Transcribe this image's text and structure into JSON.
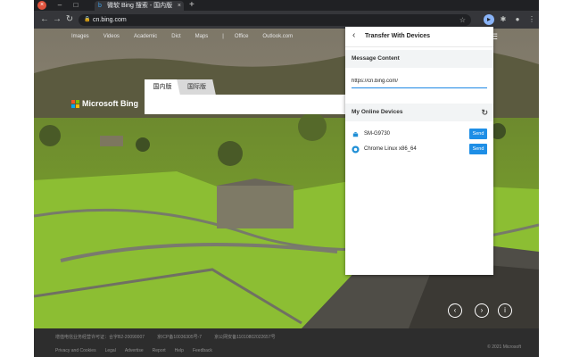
{
  "tab": {
    "title": "微软 Bing 搜索 - 国内版"
  },
  "omnibox": {
    "url": "cn.bing.com"
  },
  "bing": {
    "nav_items": [
      "Images",
      "Videos",
      "Academic",
      "Dict",
      "Maps"
    ],
    "nav_separator": "|",
    "nav_items_right": [
      "Office",
      "Outlook.com"
    ],
    "tab_cn": "国内版",
    "tab_intl": "国际版",
    "logo_text": "Microsoft Bing",
    "logo_colors": [
      "#f35325",
      "#81bc06",
      "#05a6f0",
      "#ffba08"
    ]
  },
  "footer": {
    "icp": [
      "增值电信业务经营许可证：合字B2-20090007",
      "京ICP备10036305号-7",
      "京公网安备11010802022657号"
    ],
    "links": [
      "Privacy and Cookies",
      "Legal",
      "Advertise",
      "Report",
      "Help",
      "Feedback"
    ],
    "copyright": "© 2021 Microsoft"
  },
  "popup": {
    "title": "Transfer With Devices",
    "message_label": "Message Content",
    "message_value": "https://cn.bing.com/",
    "devices_label": "My Online Devices",
    "devices": [
      {
        "name": "SM-G9730",
        "icon": "android-icon",
        "send": "Send"
      },
      {
        "name": "Chrome Linux x86_64",
        "icon": "chrome-icon",
        "send": "Send"
      }
    ]
  },
  "colors": {
    "accent": "#1e8ee6",
    "android": "#3ddc84"
  }
}
